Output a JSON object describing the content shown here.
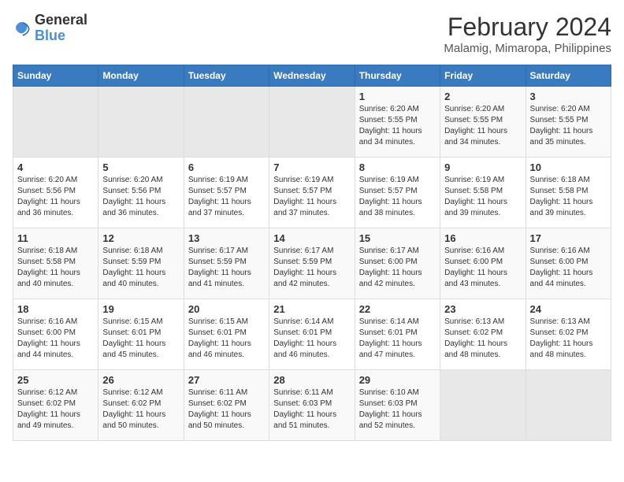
{
  "logo": {
    "line1": "General",
    "line2": "Blue"
  },
  "title": "February 2024",
  "subtitle": "Malamig, Mimaropa, Philippines",
  "weekdays": [
    "Sunday",
    "Monday",
    "Tuesday",
    "Wednesday",
    "Thursday",
    "Friday",
    "Saturday"
  ],
  "weeks": [
    [
      {
        "day": "",
        "sunrise": "",
        "sunset": "",
        "daylight": ""
      },
      {
        "day": "",
        "sunrise": "",
        "sunset": "",
        "daylight": ""
      },
      {
        "day": "",
        "sunrise": "",
        "sunset": "",
        "daylight": ""
      },
      {
        "day": "",
        "sunrise": "",
        "sunset": "",
        "daylight": ""
      },
      {
        "day": "1",
        "sunrise": "Sunrise: 6:20 AM",
        "sunset": "Sunset: 5:55 PM",
        "daylight": "Daylight: 11 hours and 34 minutes."
      },
      {
        "day": "2",
        "sunrise": "Sunrise: 6:20 AM",
        "sunset": "Sunset: 5:55 PM",
        "daylight": "Daylight: 11 hours and 34 minutes."
      },
      {
        "day": "3",
        "sunrise": "Sunrise: 6:20 AM",
        "sunset": "Sunset: 5:55 PM",
        "daylight": "Daylight: 11 hours and 35 minutes."
      }
    ],
    [
      {
        "day": "4",
        "sunrise": "Sunrise: 6:20 AM",
        "sunset": "Sunset: 5:56 PM",
        "daylight": "Daylight: 11 hours and 36 minutes."
      },
      {
        "day": "5",
        "sunrise": "Sunrise: 6:20 AM",
        "sunset": "Sunset: 5:56 PM",
        "daylight": "Daylight: 11 hours and 36 minutes."
      },
      {
        "day": "6",
        "sunrise": "Sunrise: 6:19 AM",
        "sunset": "Sunset: 5:57 PM",
        "daylight": "Daylight: 11 hours and 37 minutes."
      },
      {
        "day": "7",
        "sunrise": "Sunrise: 6:19 AM",
        "sunset": "Sunset: 5:57 PM",
        "daylight": "Daylight: 11 hours and 37 minutes."
      },
      {
        "day": "8",
        "sunrise": "Sunrise: 6:19 AM",
        "sunset": "Sunset: 5:57 PM",
        "daylight": "Daylight: 11 hours and 38 minutes."
      },
      {
        "day": "9",
        "sunrise": "Sunrise: 6:19 AM",
        "sunset": "Sunset: 5:58 PM",
        "daylight": "Daylight: 11 hours and 39 minutes."
      },
      {
        "day": "10",
        "sunrise": "Sunrise: 6:18 AM",
        "sunset": "Sunset: 5:58 PM",
        "daylight": "Daylight: 11 hours and 39 minutes."
      }
    ],
    [
      {
        "day": "11",
        "sunrise": "Sunrise: 6:18 AM",
        "sunset": "Sunset: 5:58 PM",
        "daylight": "Daylight: 11 hours and 40 minutes."
      },
      {
        "day": "12",
        "sunrise": "Sunrise: 6:18 AM",
        "sunset": "Sunset: 5:59 PM",
        "daylight": "Daylight: 11 hours and 40 minutes."
      },
      {
        "day": "13",
        "sunrise": "Sunrise: 6:17 AM",
        "sunset": "Sunset: 5:59 PM",
        "daylight": "Daylight: 11 hours and 41 minutes."
      },
      {
        "day": "14",
        "sunrise": "Sunrise: 6:17 AM",
        "sunset": "Sunset: 5:59 PM",
        "daylight": "Daylight: 11 hours and 42 minutes."
      },
      {
        "day": "15",
        "sunrise": "Sunrise: 6:17 AM",
        "sunset": "Sunset: 6:00 PM",
        "daylight": "Daylight: 11 hours and 42 minutes."
      },
      {
        "day": "16",
        "sunrise": "Sunrise: 6:16 AM",
        "sunset": "Sunset: 6:00 PM",
        "daylight": "Daylight: 11 hours and 43 minutes."
      },
      {
        "day": "17",
        "sunrise": "Sunrise: 6:16 AM",
        "sunset": "Sunset: 6:00 PM",
        "daylight": "Daylight: 11 hours and 44 minutes."
      }
    ],
    [
      {
        "day": "18",
        "sunrise": "Sunrise: 6:16 AM",
        "sunset": "Sunset: 6:00 PM",
        "daylight": "Daylight: 11 hours and 44 minutes."
      },
      {
        "day": "19",
        "sunrise": "Sunrise: 6:15 AM",
        "sunset": "Sunset: 6:01 PM",
        "daylight": "Daylight: 11 hours and 45 minutes."
      },
      {
        "day": "20",
        "sunrise": "Sunrise: 6:15 AM",
        "sunset": "Sunset: 6:01 PM",
        "daylight": "Daylight: 11 hours and 46 minutes."
      },
      {
        "day": "21",
        "sunrise": "Sunrise: 6:14 AM",
        "sunset": "Sunset: 6:01 PM",
        "daylight": "Daylight: 11 hours and 46 minutes."
      },
      {
        "day": "22",
        "sunrise": "Sunrise: 6:14 AM",
        "sunset": "Sunset: 6:01 PM",
        "daylight": "Daylight: 11 hours and 47 minutes."
      },
      {
        "day": "23",
        "sunrise": "Sunrise: 6:13 AM",
        "sunset": "Sunset: 6:02 PM",
        "daylight": "Daylight: 11 hours and 48 minutes."
      },
      {
        "day": "24",
        "sunrise": "Sunrise: 6:13 AM",
        "sunset": "Sunset: 6:02 PM",
        "daylight": "Daylight: 11 hours and 48 minutes."
      }
    ],
    [
      {
        "day": "25",
        "sunrise": "Sunrise: 6:12 AM",
        "sunset": "Sunset: 6:02 PM",
        "daylight": "Daylight: 11 hours and 49 minutes."
      },
      {
        "day": "26",
        "sunrise": "Sunrise: 6:12 AM",
        "sunset": "Sunset: 6:02 PM",
        "daylight": "Daylight: 11 hours and 50 minutes."
      },
      {
        "day": "27",
        "sunrise": "Sunrise: 6:11 AM",
        "sunset": "Sunset: 6:02 PM",
        "daylight": "Daylight: 11 hours and 50 minutes."
      },
      {
        "day": "28",
        "sunrise": "Sunrise: 6:11 AM",
        "sunset": "Sunset: 6:03 PM",
        "daylight": "Daylight: 11 hours and 51 minutes."
      },
      {
        "day": "29",
        "sunrise": "Sunrise: 6:10 AM",
        "sunset": "Sunset: 6:03 PM",
        "daylight": "Daylight: 11 hours and 52 minutes."
      },
      {
        "day": "",
        "sunrise": "",
        "sunset": "",
        "daylight": ""
      },
      {
        "day": "",
        "sunrise": "",
        "sunset": "",
        "daylight": ""
      }
    ]
  ]
}
